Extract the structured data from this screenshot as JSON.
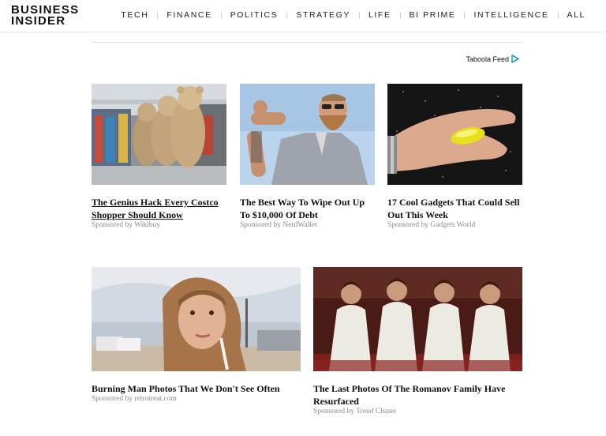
{
  "header": {
    "logo_line1": "BUSINESS",
    "logo_line2": "INSIDER",
    "nav": [
      "TECH",
      "FINANCE",
      "POLITICS",
      "STRATEGY",
      "LIFE",
      "BI PRIME",
      "INTELLIGENCE",
      "ALL"
    ]
  },
  "taboola": {
    "label": "Taboola Feed",
    "icon": "taboola-play-icon",
    "accent": "#1ba0d6"
  },
  "cards": [
    {
      "title": "The Genius Hack Every Costco Shopper Should Know",
      "sponsor": "Sponsored by Wikibuy",
      "image": "costco-teddy-bears"
    },
    {
      "title": "The Best Way To Wipe Out Up To $10,000 Of Debt",
      "sponsor": "Sponsored by NerdWallet",
      "image": "bearded-man-flexing"
    },
    {
      "title": "17 Cool Gadgets That Could Sell Out This Week",
      "sponsor": "Sponsored by Gadgets World",
      "image": "hand-yellow-gadget"
    },
    {
      "title": "Burning Man Photos That We Don't See Often",
      "sponsor": "Sponsored by retrotreat.com",
      "image": "woman-desert-selfie"
    },
    {
      "title": "The Last Photos Of The Romanov Family Have Resurfaced",
      "sponsor": "Sponsored by Trend Chaser",
      "image": "romanov-sisters"
    }
  ]
}
